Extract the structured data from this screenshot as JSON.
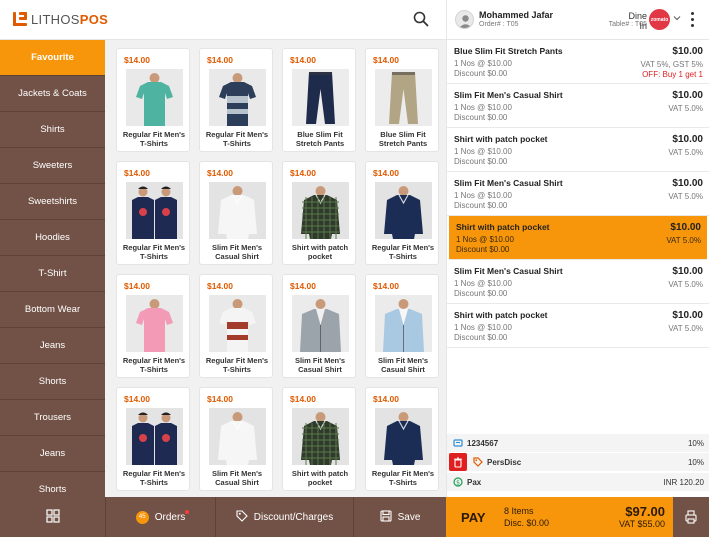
{
  "brand": {
    "prefix": "LITHOS",
    "suffix": "POS",
    "logo_icon": "lithos-logo-icon"
  },
  "header": {
    "search_icon": "search-icon",
    "customer_name": "Mohammed Jafar",
    "order_number": "Order# : T05",
    "service_mode": "Dine In",
    "table_number": "Table# : T05",
    "aggregator_badge": "zomato",
    "menu_icon": "more-vertical-icon"
  },
  "categories": [
    {
      "label": "Favourite",
      "active": true
    },
    {
      "label": "Jackets & Coats"
    },
    {
      "label": "Shirts"
    },
    {
      "label": "Sweeters"
    },
    {
      "label": "Sweetshirts"
    },
    {
      "label": "Hoodies"
    },
    {
      "label": "T-Shirt"
    },
    {
      "label": "Bottom Wear"
    },
    {
      "label": "Jeans"
    },
    {
      "label": "Shorts"
    },
    {
      "label": "Trousers"
    },
    {
      "label": "Jeans"
    },
    {
      "label": "Shorts"
    }
  ],
  "products": [
    {
      "price": "$14.00",
      "name": "Regular Fit Men's T-Shirts",
      "image": "teal-tshirt"
    },
    {
      "price": "$14.00",
      "name": "Regular Fit Men's T-Shirts",
      "image": "striped-tshirt"
    },
    {
      "price": "$14.00",
      "name": "Blue Slim Fit Stretch Pants",
      "image": "navy-pants"
    },
    {
      "price": "$14.00",
      "name": "Blue Slim Fit Stretch Pants",
      "image": "khaki-pants"
    },
    {
      "price": "$14.00",
      "name": "Regular Fit Men's T-Shirts",
      "image": "printed-tshirts-duo"
    },
    {
      "price": "$14.00",
      "name": "Slim Fit Men's Casual Shirt",
      "image": "white-shirt"
    },
    {
      "price": "$14.00",
      "name": "Shirt with patch pocket",
      "image": "green-check-shirt"
    },
    {
      "price": "$14.00",
      "name": "Regular Fit Men's T-Shirts",
      "image": "navy-polo"
    },
    {
      "price": "$14.00",
      "name": "Regular Fit Men's T-Shirts",
      "image": "pink-tshirt"
    },
    {
      "price": "$14.00",
      "name": "Regular Fit Men's T-Shirts",
      "image": "white-graphic-tshirt"
    },
    {
      "price": "$14.00",
      "name": "Slim Fit Men's Casual Shirt",
      "image": "grey-jacket"
    },
    {
      "price": "$14.00",
      "name": "Slim Fit Men's Casual Shirt",
      "image": "lightblue-suit"
    },
    {
      "price": "$14.00",
      "name": "Regular Fit Men's T-Shirts",
      "image": "printed-tshirts-duo"
    },
    {
      "price": "$14.00",
      "name": "Slim Fit Men's Casual Shirt",
      "image": "white-shirt"
    },
    {
      "price": "$14.00",
      "name": "Shirt with patch pocket",
      "image": "green-check-shirt"
    },
    {
      "price": "$14.00",
      "name": "Regular Fit Men's T-Shirts",
      "image": "navy-polo"
    }
  ],
  "order_items": [
    {
      "name": "Blue Slim Fit Stretch Pants",
      "qty": "1 Nos @ $10.00",
      "discount": "Discount $0.00",
      "amount": "$10.00",
      "tax": "VAT 5%, GST 5%",
      "offer": "OFF: Buy 1 get 1"
    },
    {
      "name": "Slim Fit Men's Casual Shirt",
      "qty": "1 Nos @ $10.00",
      "discount": "Discount $0.00",
      "amount": "$10.00",
      "tax": "VAT 5.0%"
    },
    {
      "name": "Shirt with patch pocket",
      "qty": "1 Nos @ $10.00",
      "discount": "Discount $0.00",
      "amount": "$10.00",
      "tax": "VAT 5.0%"
    },
    {
      "name": "Slim Fit Men's Casual Shirt",
      "qty": "1 Nos @ $10.00",
      "discount": "Discount $0.00",
      "amount": "$10.00",
      "tax": "VAT 5.0%"
    },
    {
      "name": "Shirt with patch pocket",
      "qty": "1 Nos @ $10.00",
      "discount": "Discount $0.00",
      "amount": "$10.00",
      "tax": "VAT 5.0%",
      "selected": true
    },
    {
      "name": "Slim Fit Men's Casual Shirt",
      "qty": "1 Nos @ $10.00",
      "discount": "Discount $0.00",
      "amount": "$10.00",
      "tax": "VAT 5.0%"
    },
    {
      "name": "Shirt with patch pocket",
      "qty": "1 Nos @ $10.00",
      "discount": "Discount $0.00",
      "amount": "$10.00",
      "tax": "VAT 5.0%"
    }
  ],
  "adjustments": [
    {
      "icon": "coupon-icon",
      "label": "1234567",
      "value": "10%"
    },
    {
      "icon": "tag-icon",
      "label": "PersDisc",
      "value": "10%",
      "delete_icon": "trash-icon"
    },
    {
      "icon": "pax-icon",
      "label": "Pax",
      "value": "INR  120.20"
    }
  ],
  "bottom_bar": {
    "grid_icon": "grid-icon",
    "orders_label": "Orders",
    "orders_count": "45",
    "discount_label": "Discount/Charges",
    "discount_icon": "discount-tag-icon",
    "save_label": "Save",
    "save_icon": "save-icon"
  },
  "pay": {
    "label": "PAY",
    "items": "8 Items",
    "discount": "Disc. $0.00",
    "total": "$97.00",
    "vat": "VAT $55.00",
    "print_icon": "receipt-printer-icon"
  },
  "colors": {
    "accent": "#f7960b",
    "sidebar": "#725247",
    "price": "#e05a00",
    "offer": "#e02020"
  }
}
